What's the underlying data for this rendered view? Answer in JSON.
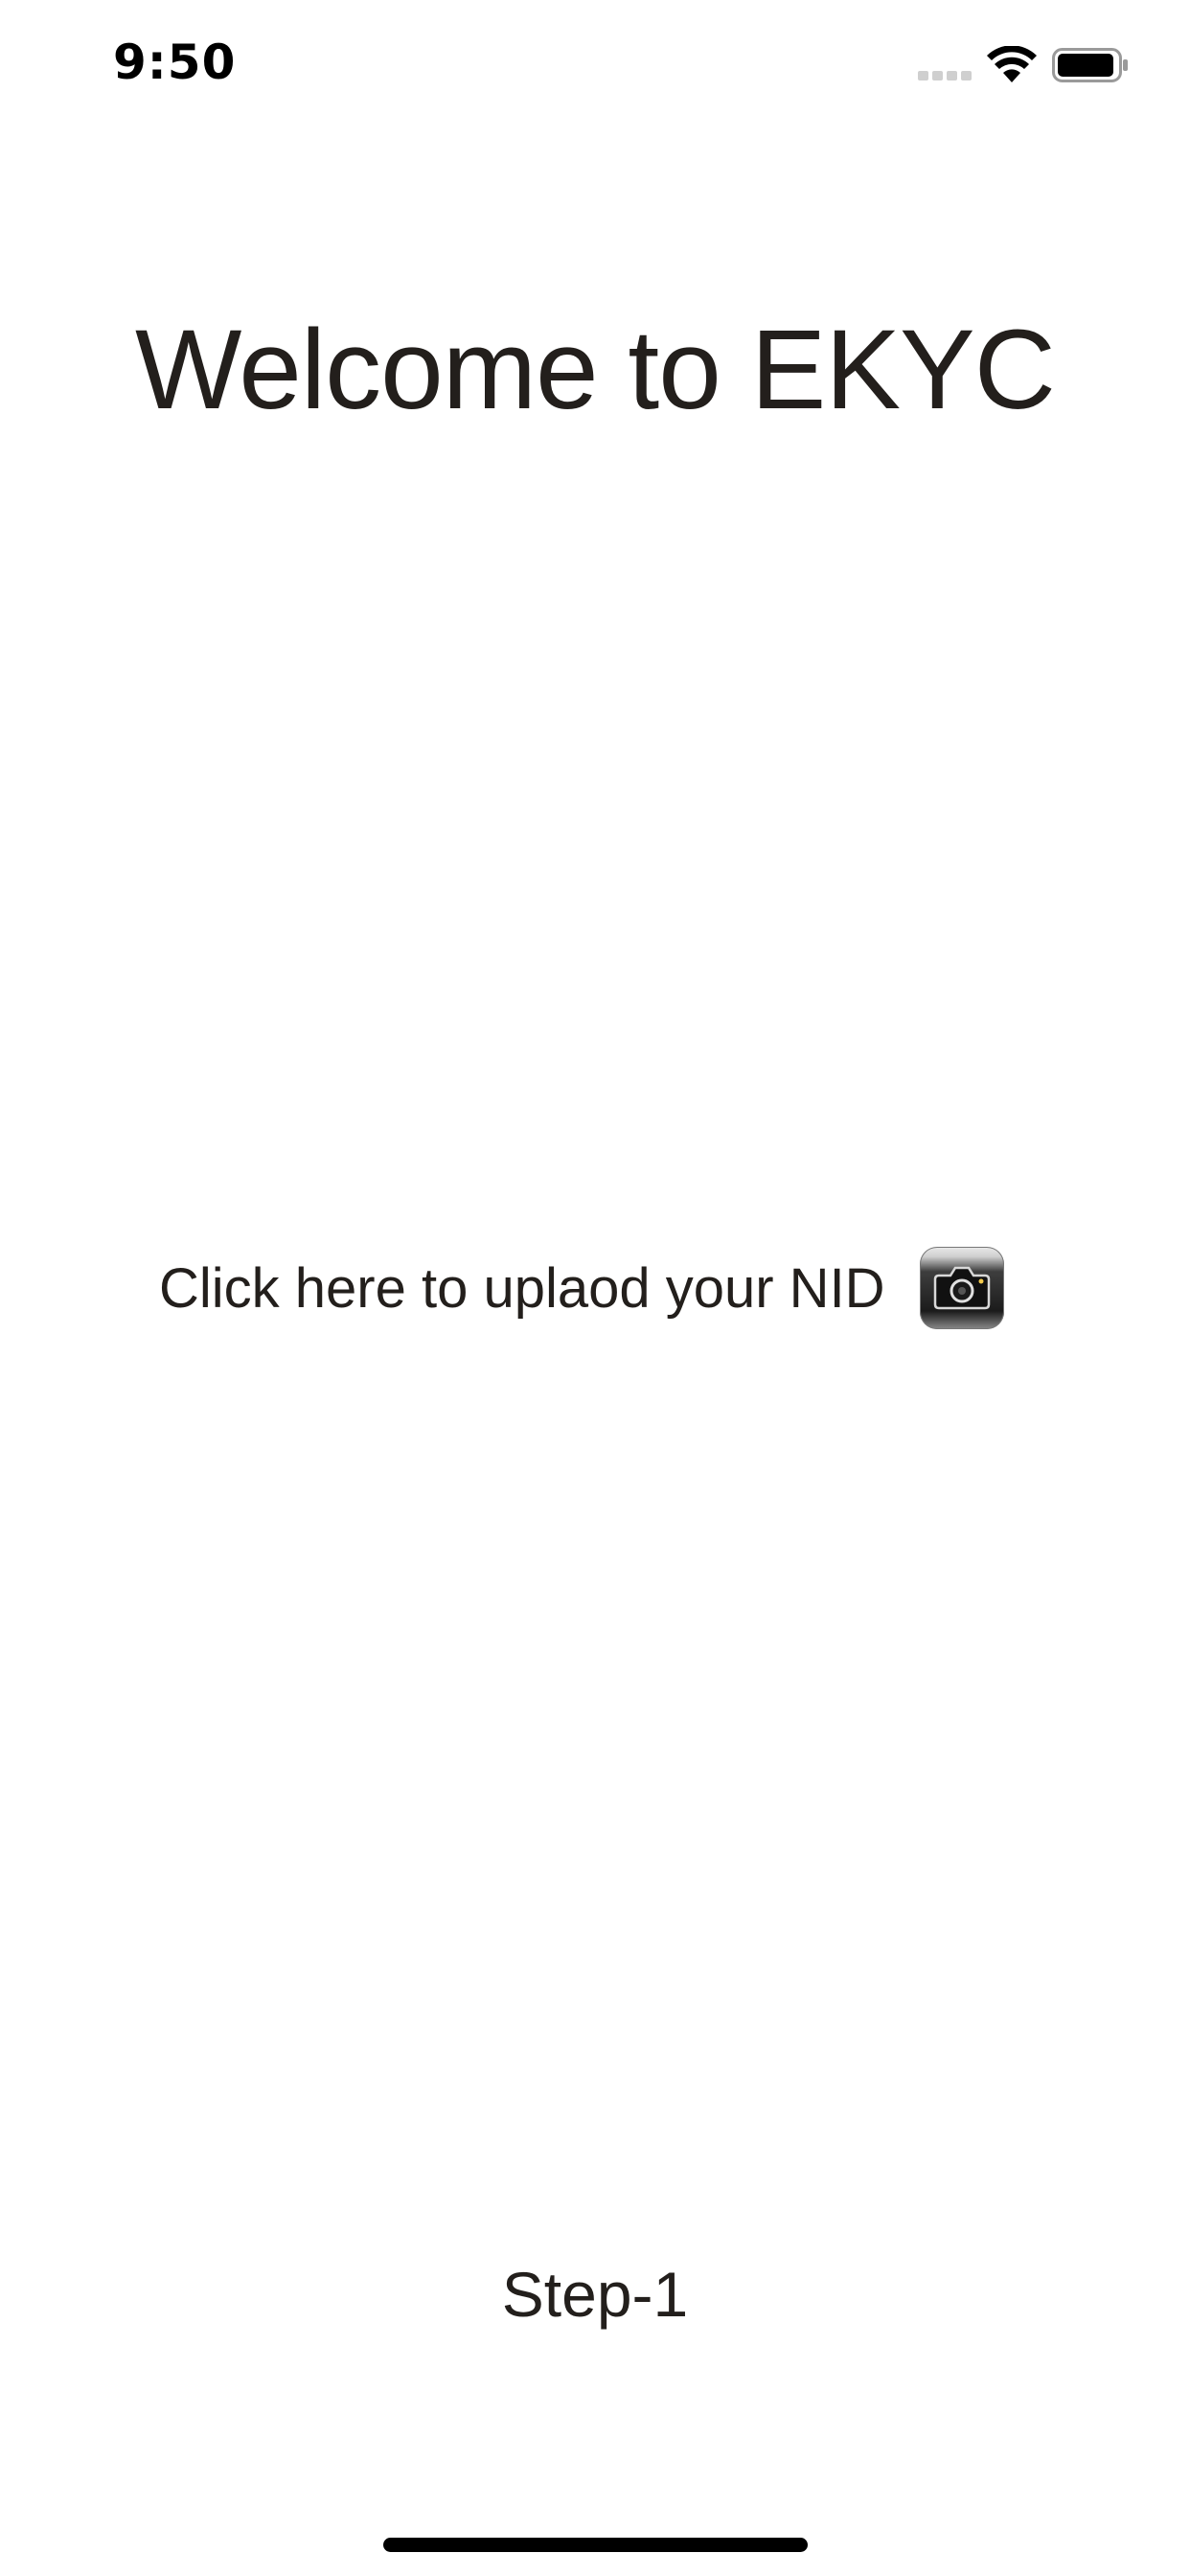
{
  "status_bar": {
    "time": "9:50"
  },
  "main": {
    "title": "Welcome to EKYC",
    "upload_label": "Click here to uplaod your NID",
    "upload_icon": "camera-icon",
    "step": "Step-1"
  },
  "colors": {
    "text": "#231f1c",
    "background": "#ffffff"
  }
}
